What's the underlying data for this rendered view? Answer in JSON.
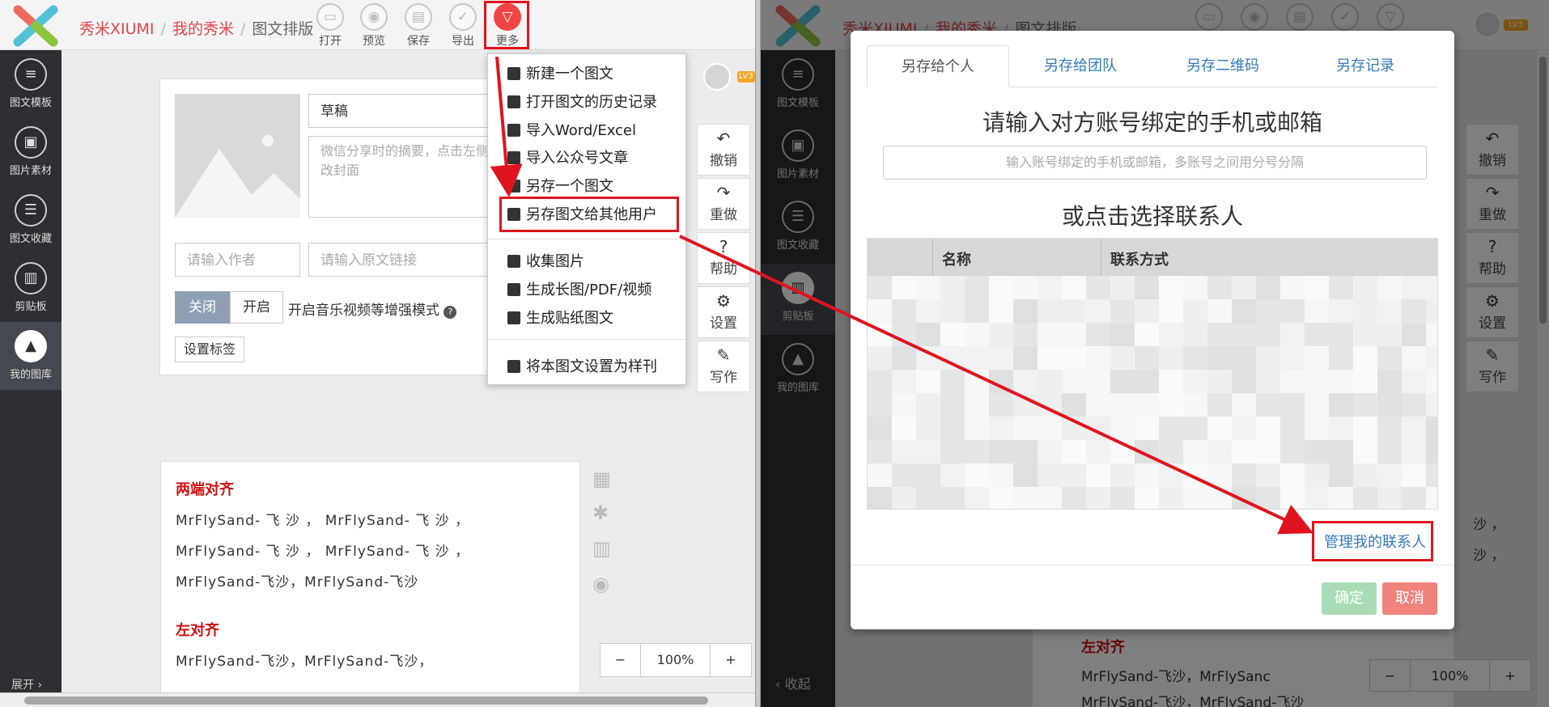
{
  "breadcrumb": {
    "site": "秀米XIUMI",
    "mine": "我的秀米",
    "current": "图文排版",
    "sep": "/"
  },
  "toolbar": {
    "open": "打开",
    "preview": "预览",
    "save": "保存",
    "export": "导出",
    "more": "更多"
  },
  "sidebar": {
    "items": [
      {
        "label": "图文模板",
        "icon": "list-icon"
      },
      {
        "label": "图片素材",
        "icon": "image-icon"
      },
      {
        "label": "图文收藏",
        "icon": "star-list-icon"
      },
      {
        "label": "剪贴板",
        "icon": "clipboard-icon"
      },
      {
        "label": "我的图库",
        "icon": "gallery-icon"
      }
    ],
    "expand": "展开",
    "collapse": "收起"
  },
  "editor": {
    "title_value": "草稿",
    "summary_placeholder": "微信分享时的摘要，点击左侧图改封面",
    "author_placeholder": "请输入作者",
    "link_placeholder": "请输入原文链接",
    "toggle_off": "关闭",
    "toggle_on": "开启",
    "enhance_label": "开启音乐视频等增强模式",
    "tag_button": "设置标签"
  },
  "menu": {
    "items": [
      "新建一个图文",
      "打开图文的历史记录",
      "导入Word/Excel",
      "导入公众号文章",
      "另存一个图文",
      "另存图文给其他用户",
      "收集图片",
      "生成长图/PDF/视频",
      "生成贴纸图文",
      "将本图文设置为样刊"
    ]
  },
  "right_tools": {
    "undo": "撤销",
    "redo": "重做",
    "help": "帮助",
    "settings": "设置",
    "write": "写作"
  },
  "content": {
    "heading1": "两端对齐",
    "para1_line1": "MrFlySand- 飞 沙 ， MrFlySand- 飞 沙 ，",
    "para1_line2": "MrFlySand- 飞 沙 ， MrFlySand- 飞 沙 ，",
    "para1_line3": "MrFlySand-飞沙，MrFlySand-飞沙",
    "heading2": "左对齐",
    "para2_line1": "MrFlySand-飞沙，MrFlySand-飞沙，",
    "right_fragment": "MrFlySand-飞沙，MrFlySanc",
    "right_fragment2": "MrFlySand-飞沙，MrFlySand-飞沙"
  },
  "zoom": {
    "out": "−",
    "level": "100%",
    "in": "+"
  },
  "badge": "LV3",
  "modal": {
    "tabs": [
      "另存给个人",
      "另存给团队",
      "另存二维码",
      "另存记录"
    ],
    "heading": "请输入对方账号绑定的手机或邮箱",
    "input_placeholder": "输入账号绑定的手机或邮箱，多账号之间用分号分隔",
    "subheading": "或点击选择联系人",
    "col_name": "名称",
    "col_contact": "联系方式",
    "manage_link": "管理我的联系人",
    "confirm": "确定",
    "cancel": "取消"
  },
  "dim": {
    "tail1": "沙 ，",
    "tail2": "沙 ，"
  },
  "colors": {
    "brand_red": "#e2454b",
    "highlight_red": "#e0141e",
    "link_blue": "#337ab7",
    "confirm_green": "#a9dcb5",
    "cancel_red": "#f0837b"
  }
}
